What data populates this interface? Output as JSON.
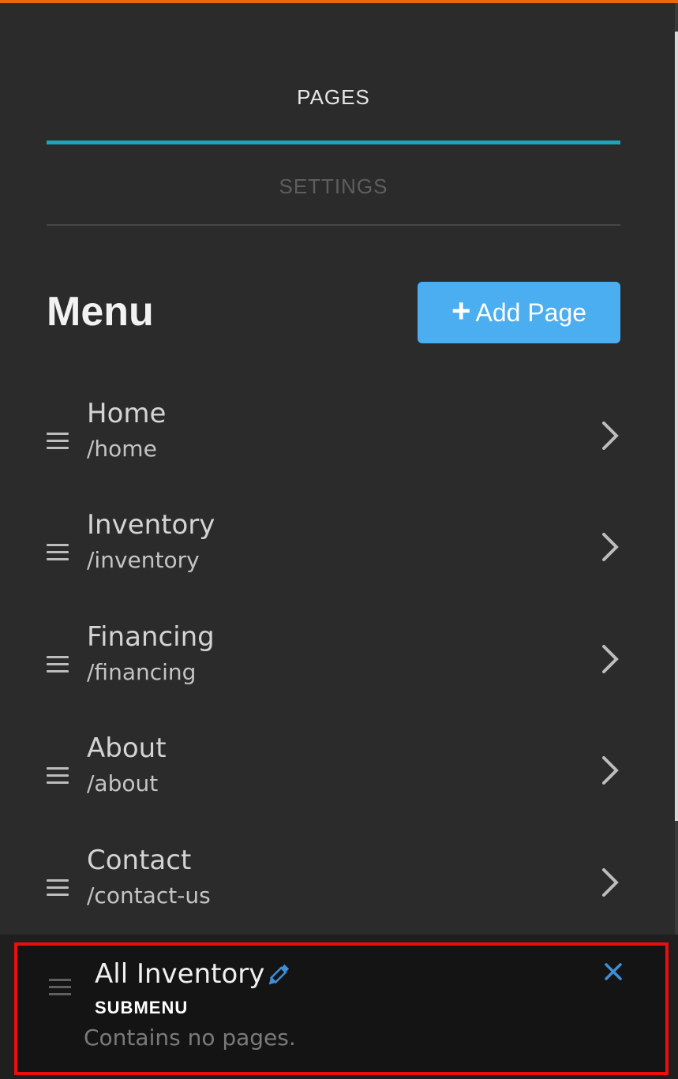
{
  "tabs": {
    "pages_label": "PAGES",
    "settings_label": "SETTINGS"
  },
  "menu": {
    "title": "Menu",
    "add_button_icon": "plus-icon",
    "add_button_label": "Add Page",
    "items": [
      {
        "title": "Home",
        "path": "/home"
      },
      {
        "title": "Inventory",
        "path": "/inventory"
      },
      {
        "title": "Financing",
        "path": "/financing"
      },
      {
        "title": "About",
        "path": "/about"
      },
      {
        "title": "Contact",
        "path": "/contact-us"
      }
    ]
  },
  "submenu": {
    "title": "All Inventory",
    "type_label": "SUBMENU",
    "empty_text": "Contains no pages.",
    "edit_icon": "pencil-icon",
    "close_icon": "close-icon"
  },
  "colors": {
    "background": "#2b2b2b",
    "accent_tab": "#1ba6b8",
    "add_button": "#4aaef0",
    "top_bar": "#e8690c",
    "highlight_border": "#ee0d0d",
    "icon_blue": "#3f8fd6"
  }
}
